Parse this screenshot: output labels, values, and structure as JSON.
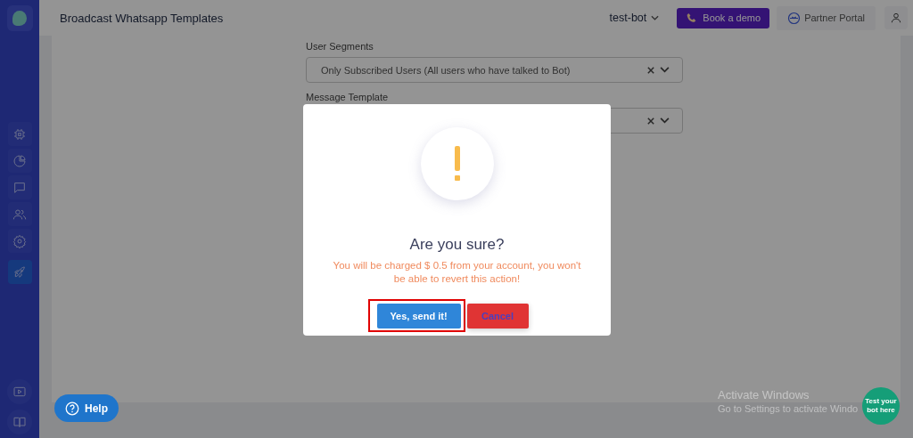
{
  "sidebar": {
    "items": [
      {
        "selected": false
      },
      {
        "selected": false
      },
      {
        "selected": false
      },
      {
        "selected": false
      },
      {
        "selected": false
      },
      {
        "selected": true
      }
    ],
    "bottom_items": [
      {
        "selected": false
      },
      {
        "selected": false
      }
    ]
  },
  "header": {
    "title": "Broadcast Whatsapp Templates",
    "bot_selector": "test-bot",
    "book_demo": "Book a demo",
    "partner_portal": "Partner Portal"
  },
  "form": {
    "fields": [
      {
        "label": "User Segments",
        "value": "Only Subscribed Users (All users who have talked to Bot)"
      },
      {
        "label": "Message Template"
      }
    ]
  },
  "dialog": {
    "title": "Are you sure?",
    "message": "You will be charged $ 0.5 from your account, you won't be able to revert this action!",
    "confirm": "Yes, send it!",
    "cancel": "Cancel",
    "confirm_highlighted": true
  },
  "help_button": "Help",
  "test_bot_bubble": "Test your bot here",
  "os_notice": {
    "title": "Activate Windows",
    "subtitle": "Go to Settings to activate Windo"
  }
}
